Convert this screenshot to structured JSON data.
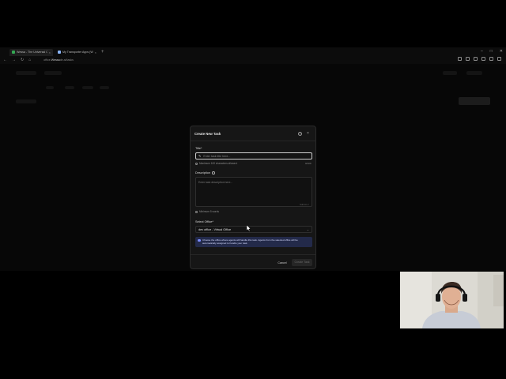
{
  "browser": {
    "tabs": [
      {
        "title": "Wessa - The Universal Connec",
        "active": true,
        "favicon_color": "#34a853"
      },
      {
        "title": "My Transporter Apps (WEMOP)",
        "active": false,
        "favicon_color": "#8ab4f8"
      }
    ],
    "new_tab": "+",
    "window_controls": {
      "minimize": "–",
      "maximize": "□",
      "close": "✕"
    },
    "nav": {
      "back": "←",
      "forward": "→",
      "reload": "↻",
      "home": "⌂"
    },
    "url": {
      "prefix": "office.",
      "domain": "Wessa",
      "rest": "de.ai/tasks"
    }
  },
  "modal": {
    "title": "Create New Task",
    "help": "?",
    "close": "×",
    "title_label": "Title*",
    "title_placeholder": "Enter task title here...",
    "title_hint": "Maximum 100 characters allowed.",
    "title_counter": "0/100",
    "description_label": "Description",
    "description_placeholder": "Enter task description here...",
    "description_submit_hint": "Submit ↵",
    "description_hint": "Minimum 5 words",
    "office_label": "Select Office*",
    "office_value": "dev office - Virtual Office",
    "office_chevron": "⌄",
    "info_text": "Choose the office where agents will handle this task. Agents from the selected office will be automatically assigned to handle your task.",
    "cancel": "Cancel",
    "create": "Create Task"
  },
  "colors": {
    "accent": "#7c8cff",
    "info_bg": "#232a4a",
    "modal_bg": "#161616"
  }
}
